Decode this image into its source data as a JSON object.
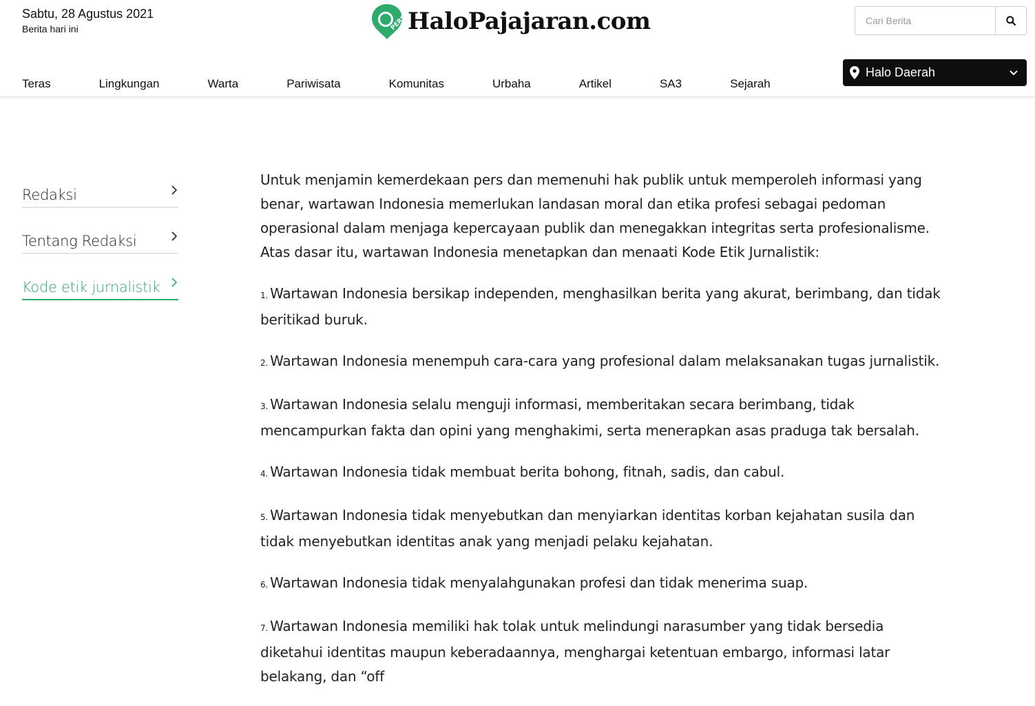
{
  "header": {
    "date": "Sabtu, 28 Agustus 2021",
    "date_sub": "Berita hari ini",
    "logo_text": "HaloPajajaran.com",
    "logo_badge": "PERS",
    "search_placeholder": "Cari Berita"
  },
  "nav": {
    "items": [
      "Teras",
      "Lingkungan",
      "Warta",
      "Pariwisata",
      "Komunitas",
      "Urbaha",
      "Artikel",
      "SA3",
      "Sejarah"
    ]
  },
  "region": {
    "label": "Halo Daerah"
  },
  "sidebar": {
    "items": [
      {
        "label": "Redaksi"
      },
      {
        "label": "Tentang Redaksi"
      },
      {
        "label": "Kode etik jurnalistik"
      }
    ]
  },
  "content": {
    "intro": "Untuk menjamin kemerdekaan pers dan memenuhi hak publik untuk memperoleh informasi yang benar, wartawan Indonesia memerlukan landasan moral dan etika profesi sebagai pedoman operasional dalam menjaga kepercayaan publik dan menegakkan integritas serta profesionalisme. Atas dasar itu, wartawan Indonesia menetapkan dan menaati Kode Etik Jurnalistik:",
    "items": [
      {
        "num": "1.",
        "text": "Wartawan Indonesia bersikap independen, menghasilkan berita yang akurat, berimbang, dan tidak beritikad buruk."
      },
      {
        "num": "2.",
        "text": "Wartawan Indonesia menempuh cara-cara yang profesional dalam melaksanakan tugas jurnalistik."
      },
      {
        "num": "3.",
        "text": "Wartawan Indonesia selalu menguji informasi, memberitakan secara berimbang, tidak mencampurkan fakta dan opini yang menghakimi, serta menerapkan asas praduga tak bersalah."
      },
      {
        "num": "4.",
        "text": "Wartawan Indonesia tidak membuat berita bohong, fitnah, sadis, dan cabul."
      },
      {
        "num": "5.",
        "text": "Wartawan Indonesia tidak menyebutkan dan menyiarkan identitas korban kejahatan susila dan tidak menyebutkan identitas anak yang menjadi pelaku kejahatan."
      },
      {
        "num": "6.",
        "text": "Wartawan Indonesia tidak menyalahgunakan profesi dan tidak menerima suap."
      },
      {
        "num": "7.",
        "text": "Wartawan Indonesia memiliki hak tolak untuk melindungi narasumber yang tidak bersedia diketahui identitas maupun keberadaannya, menghargai ketentuan embargo, informasi latar belakang, dan “off"
      }
    ]
  },
  "colors": {
    "accent": "#2eaa6c",
    "dark": "#0e0e0e"
  }
}
